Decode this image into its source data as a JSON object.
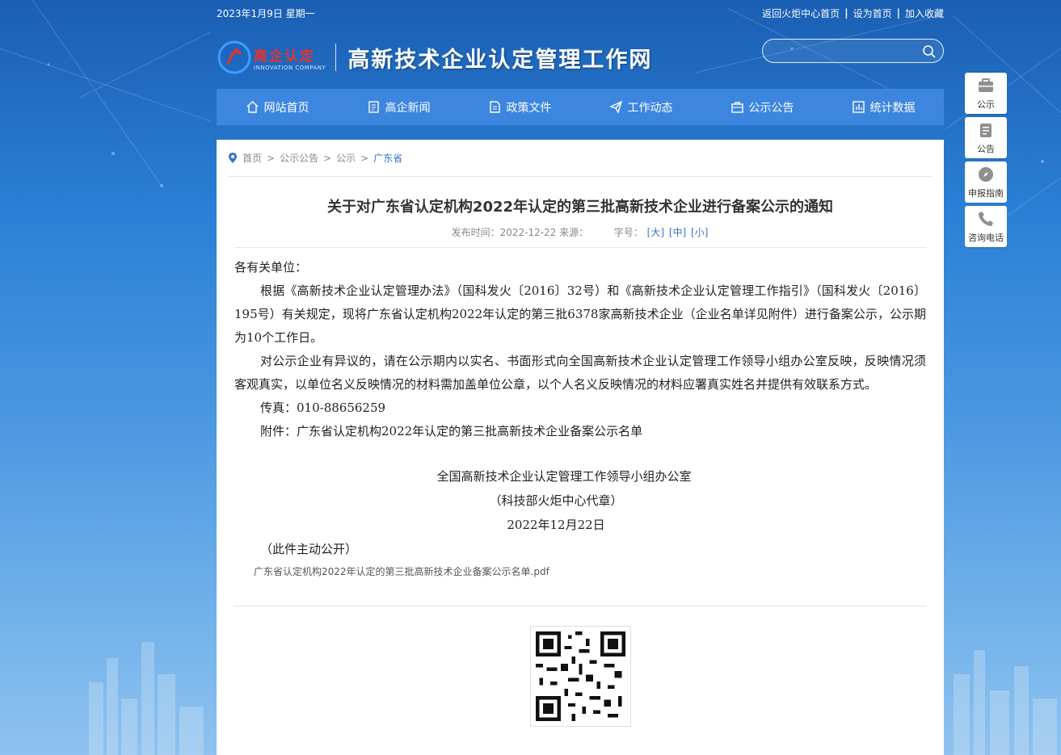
{
  "topbar": {
    "date": "2023年1月9日 星期一",
    "links": [
      "返回火炬中心首页",
      "设为首页",
      "加入收藏"
    ]
  },
  "header": {
    "logo_cn": "高企认定",
    "logo_en": "INNOVATION COMPANY",
    "site_title": "高新技术企业认定管理工作网",
    "search_placeholder": ""
  },
  "nav": {
    "items": [
      {
        "label": "网站首页",
        "icon": "home-icon"
      },
      {
        "label": "高企新闻",
        "icon": "news-icon"
      },
      {
        "label": "政策文件",
        "icon": "document-icon"
      },
      {
        "label": "工作动态",
        "icon": "paper-plane-icon"
      },
      {
        "label": "公示公告",
        "icon": "briefcase-icon"
      },
      {
        "label": "统计数据",
        "icon": "chart-icon"
      }
    ]
  },
  "breadcrumb": {
    "items": [
      "首页",
      "公示公告",
      "公示",
      "广东省"
    ],
    "separator": ">"
  },
  "article": {
    "title": "关于对广东省认定机构2022年认定的第三批高新技术企业进行备案公示的通知",
    "meta_date": "发布时间：2022-12-22 来源：",
    "meta_font": "字号：",
    "font_sizes": [
      "[大]",
      "[中]",
      "[小]"
    ],
    "salutation": "各有关单位：",
    "para1": "根据《高新技术企业认定管理办法》（国科发火〔2016〕32号）和《高新技术企业认定管理工作指引》（国科发火〔2016〕195号）有关规定，现将广东省认定机构2022年认定的第三批6378家高新技术企业（企业名单详见附件）进行备案公示，公示期为10个工作日。",
    "para2": "对公示企业有异议的，请在公示期内以实名、书面形式向全国高新技术企业认定管理工作领导小组办公室反映，反映情况须客观真实，以单位名义反映情况的材料需加盖单位公章，以个人名义反映情况的材料应署真实姓名并提供有效联系方式。",
    "fax": "传真：010-88656259",
    "attachment": "附件：广东省认定机构2022年认定的第三批高新技术企业备案公示名单",
    "signature_org": "全国高新技术企业认定管理工作领导小组办公室",
    "signature_seal": "（科技部火炬中心代章）",
    "signature_date": "2022年12月22日",
    "public_note": "（此件主动公开）",
    "file_name": "广东省认定机构2022年认定的第三批高新技术企业备案公示名单.pdf"
  },
  "side": {
    "items": [
      {
        "label": "公示",
        "icon": "briefcase-icon"
      },
      {
        "label": "公告",
        "icon": "clipboard-icon"
      },
      {
        "label": "申报指南",
        "icon": "compass-icon"
      },
      {
        "label": "咨询电话",
        "icon": "phone-icon"
      }
    ]
  },
  "colors": {
    "nav_bg": "#3d86e0",
    "link_blue": "#3476c9",
    "logo_red": "#e8322c"
  }
}
